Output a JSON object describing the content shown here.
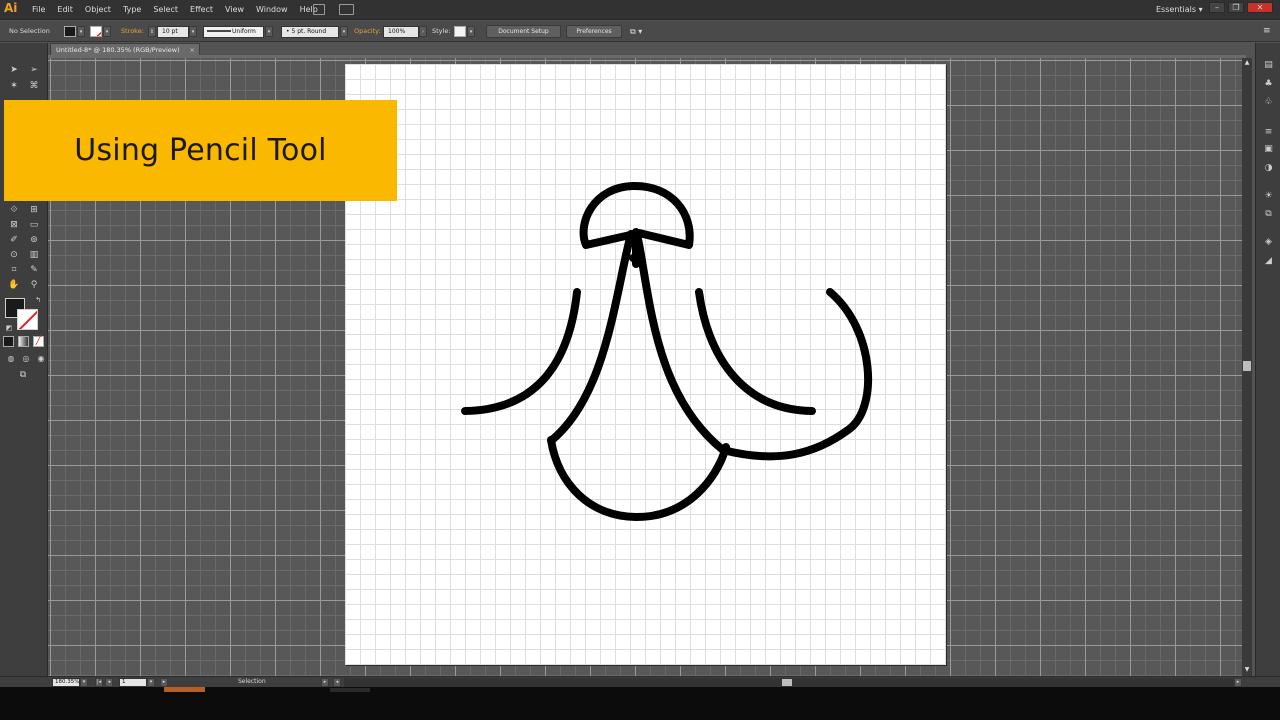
{
  "app": {
    "logo": "Ai"
  },
  "menu": [
    "File",
    "Edit",
    "Object",
    "Type",
    "Select",
    "Effect",
    "View",
    "Window",
    "Help"
  ],
  "workspace": {
    "label": "Essentials",
    "arrow": "▾"
  },
  "window_controls": {
    "minimize": "–",
    "restore": "❐",
    "close": "✕"
  },
  "control_bar": {
    "selection_label": "No Selection",
    "stroke_label": "Stroke:",
    "stroke_weight": "10 pt",
    "profile": "Uniform",
    "brush": "5 pt. Round",
    "opacity_label": "Opacity:",
    "opacity": "100%",
    "style_label": "Style:",
    "document_setup": "Document Setup",
    "preferences": "Preferences"
  },
  "document": {
    "tab_title": "Untitled-8* @ 180.35% (RGB/Preview)",
    "close": "×"
  },
  "status_bar": {
    "zoom": "180.35%",
    "artboard": "1",
    "tool": "Selection"
  },
  "overlay": {
    "caption": "Using Pencil Tool",
    "color": "#fbb800"
  },
  "colors": {
    "fill": "#1a1a1a",
    "stroke": "#000000",
    "accent": "#f0a02a"
  },
  "icons": {
    "selection": "selection-tool-icon",
    "direct_selection": "direct-selection-tool-icon",
    "magic_wand": "magic-wand-tool-icon",
    "lasso": "lasso-tool-icon",
    "eyedropper": "eyedropper-tool-icon",
    "hand": "hand-tool-icon",
    "zoom": "zoom-tool-icon"
  }
}
